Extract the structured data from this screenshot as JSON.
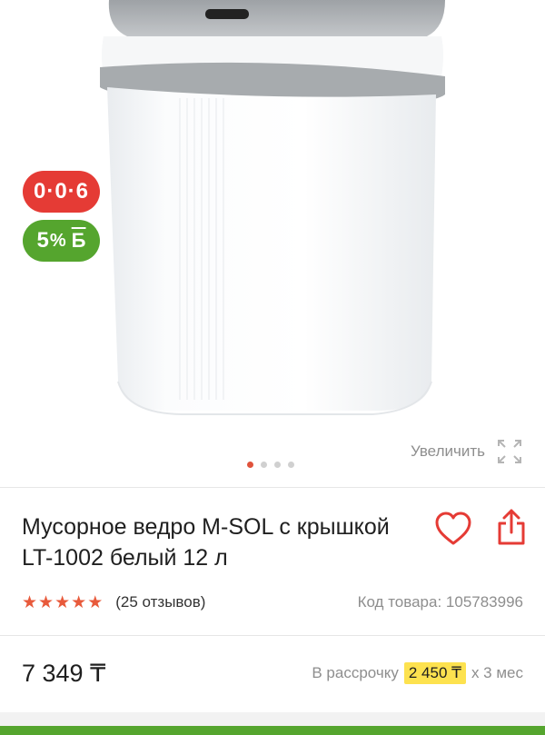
{
  "product": {
    "title": "Мусорное ведро M-SOL с крышкой LT-1002 белый 12 л",
    "reviews": "(25 отзывов)",
    "sku": "Код товара: 105783996",
    "rating": 5
  },
  "badges": {
    "installment": "0·0·6",
    "bonus_value": "5",
    "bonus_percent": "%",
    "bonus_letter": "Б"
  },
  "gallery": {
    "zoom_label": "Увеличить",
    "current_image": 1,
    "total_images": 4
  },
  "price": {
    "value": "7 349 ₸",
    "installment_prefix": "В рассрочку",
    "installment_amount": "2 450 ₸",
    "installment_suffix": "х 3 мес"
  },
  "colors": {
    "accent_red": "#e53b35",
    "bonus_green": "#55a52e",
    "highlight_yellow": "#fde24f"
  },
  "icons": {
    "favorite": "heart-icon",
    "share": "share-icon",
    "zoom": "expand-icon"
  }
}
